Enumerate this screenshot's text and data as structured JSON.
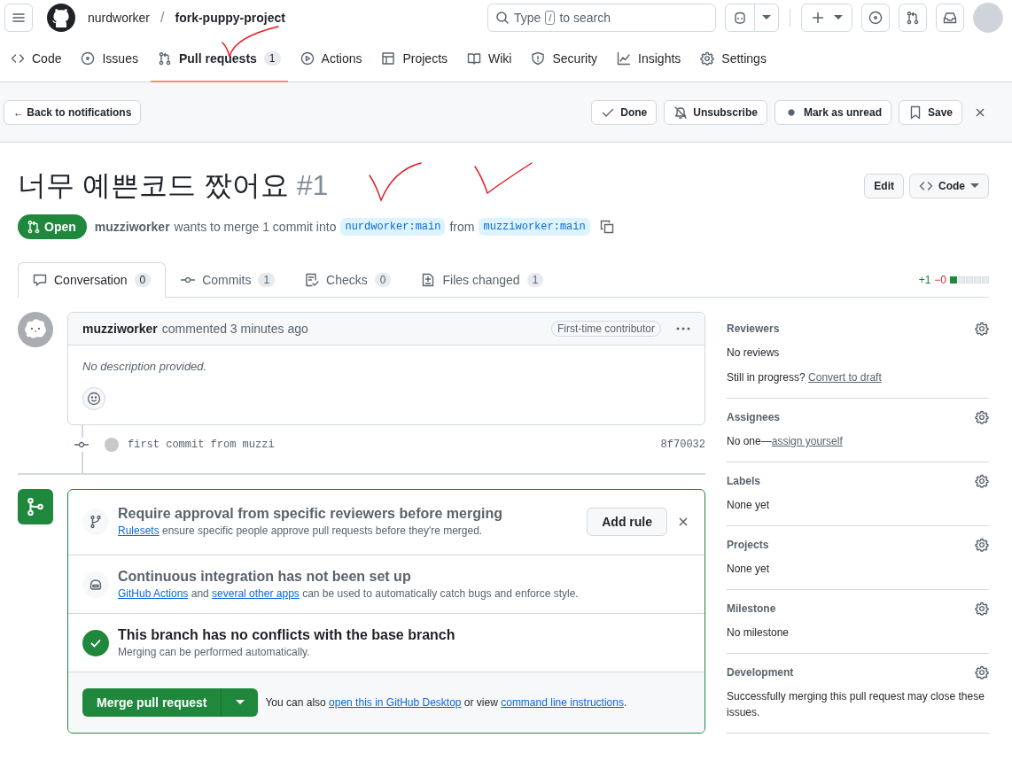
{
  "header": {
    "owner": "nurdworker",
    "separator": "/",
    "repo": "fork-puppy-project",
    "search": {
      "before": "Type",
      "key": "/",
      "after": "to search"
    }
  },
  "repo_nav": [
    {
      "kind": "code",
      "label": "Code",
      "selected": false
    },
    {
      "kind": "issue",
      "label": "Issues",
      "selected": false
    },
    {
      "kind": "pull",
      "label": "Pull requests",
      "count": "1",
      "selected": true
    },
    {
      "kind": "play",
      "label": "Actions",
      "selected": false
    },
    {
      "kind": "table",
      "label": "Projects",
      "selected": false
    },
    {
      "kind": "book",
      "label": "Wiki",
      "selected": false
    },
    {
      "kind": "shield",
      "label": "Security",
      "selected": false
    },
    {
      "kind": "graph",
      "label": "Insights",
      "selected": false
    },
    {
      "kind": "gear",
      "label": "Settings",
      "selected": false
    }
  ],
  "notification_bar": {
    "back": "← Back to notifications",
    "actions": [
      {
        "kind": "check",
        "label": "Done"
      },
      {
        "kind": "bell-off",
        "label": "Unsubscribe"
      },
      {
        "kind": "dot",
        "label": "Mark as unread"
      },
      {
        "kind": "bookmark",
        "label": "Save"
      }
    ]
  },
  "pr": {
    "title": "너무 예쁜코드 짰어요",
    "number": "#1",
    "state": "Open",
    "author": "muzziworker",
    "summary": "wants to merge 1 commit into",
    "base": "nurdworker:main",
    "from_word": "from",
    "head": "muzziworker:main",
    "edit": "Edit",
    "code": "Code"
  },
  "pr_tabs": [
    {
      "kind": "comment",
      "label": "Conversation",
      "count": "0",
      "selected": true
    },
    {
      "kind": "commit",
      "label": "Commits",
      "count": "1",
      "selected": false
    },
    {
      "kind": "checklist",
      "label": "Checks",
      "count": "0",
      "selected": false
    },
    {
      "kind": "diff",
      "label": "Files changed",
      "count": "1",
      "selected": false
    }
  ],
  "diffstat": {
    "added": "+1",
    "removed": "−0",
    "blocks": [
      {
        "kind": "added"
      },
      {
        "kind": "neutral"
      },
      {
        "kind": "neutral"
      },
      {
        "kind": "neutral"
      },
      {
        "kind": "neutral"
      }
    ]
  },
  "comment": {
    "author": "muzziworker",
    "meta": "commented 3 minutes ago",
    "badge": "First-time contributor",
    "body": "No description provided."
  },
  "commit": {
    "message": "first commit from muzzi",
    "sha": "8f70032"
  },
  "merge_box": {
    "sections": [
      {
        "kind": "ruleset",
        "title": "Require approval from specific reviewers before merging",
        "parts": [
          {
            "kind": "link",
            "text": "Rulesets"
          },
          {
            "kind": "text",
            "text": " ensure specific people approve pull requests before they're merged."
          }
        ],
        "button": "Add rule"
      },
      {
        "kind": "ci",
        "title": "Continuous integration has not been set up",
        "parts": [
          {
            "kind": "link",
            "text": "GitHub Actions"
          },
          {
            "kind": "text",
            "text": " and "
          },
          {
            "kind": "link",
            "text": "several other apps"
          },
          {
            "kind": "text",
            "text": " can be used to automatically catch bugs and enforce style."
          }
        ]
      },
      {
        "kind": "ok",
        "title": "This branch has no conflicts with the base branch",
        "parts": [
          {
            "kind": "text",
            "text": "Merging can be performed automatically."
          }
        ]
      }
    ],
    "merge_button": "Merge pull request",
    "footer_parts": [
      {
        "kind": "text",
        "text": "You can also "
      },
      {
        "kind": "link",
        "text": "open this in GitHub Desktop"
      },
      {
        "kind": "text",
        "text": " or view "
      },
      {
        "kind": "link",
        "text": "command line instructions"
      },
      {
        "kind": "text",
        "text": "."
      }
    ]
  },
  "sidebar": [
    {
      "title": "Reviewers",
      "lines": [
        [
          {
            "kind": "text",
            "text": "No reviews"
          }
        ],
        [
          {
            "kind": "text",
            "text": "Still in progress? "
          },
          {
            "kind": "link",
            "text": "Convert to draft"
          }
        ]
      ]
    },
    {
      "title": "Assignees",
      "lines": [
        [
          {
            "kind": "text",
            "text": "No one—"
          },
          {
            "kind": "link",
            "text": "assign yourself"
          }
        ]
      ]
    },
    {
      "title": "Labels",
      "lines": [
        [
          {
            "kind": "text",
            "text": "None yet"
          }
        ]
      ]
    },
    {
      "title": "Projects",
      "lines": [
        [
          {
            "kind": "text",
            "text": "None yet"
          }
        ]
      ]
    },
    {
      "title": "Milestone",
      "lines": [
        [
          {
            "kind": "text",
            "text": "No milestone"
          }
        ]
      ]
    },
    {
      "title": "Development",
      "lines": [
        [
          {
            "kind": "text",
            "text": "Successfully merging this pull request may close these issues."
          }
        ]
      ]
    }
  ],
  "annotations": [
    {
      "kind": "check"
    },
    {
      "kind": "check"
    },
    {
      "kind": "check"
    }
  ]
}
